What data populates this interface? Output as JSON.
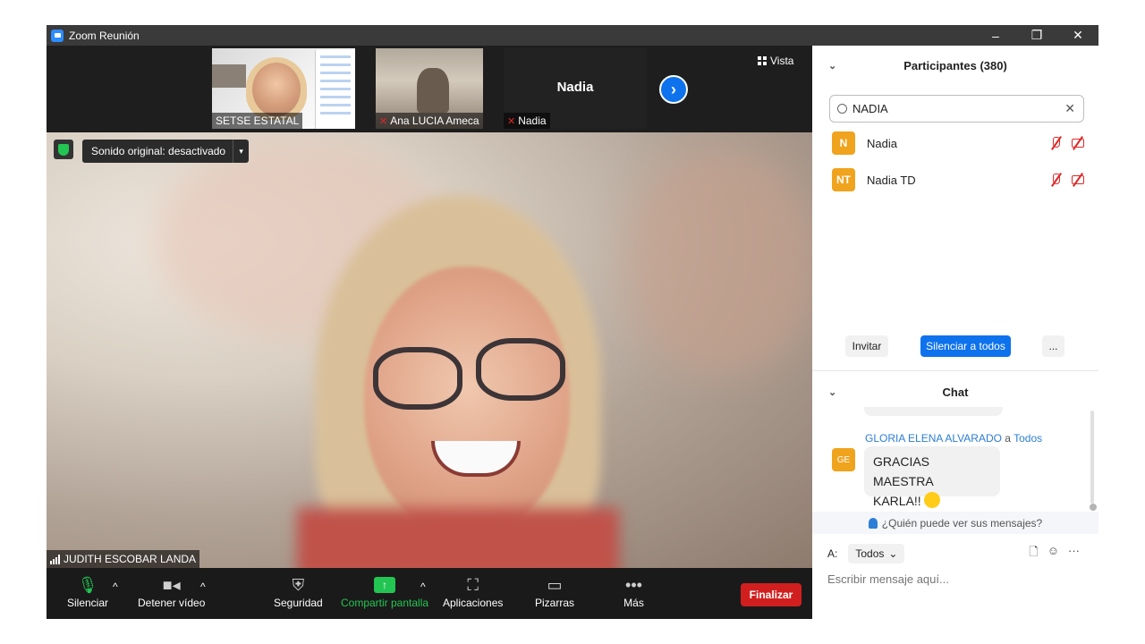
{
  "window": {
    "title": "Zoom Reunión",
    "minimize": "–",
    "restore": "❐",
    "close": "✕",
    "accent_color": "#2d8cff"
  },
  "gallery_strip": {
    "thumbnails": [
      {
        "name": "SETSE ESTATAL",
        "muted": false
      },
      {
        "name": "Ana LUCIA Ameca",
        "muted": true
      },
      {
        "name": "Nadia",
        "muted": true,
        "display_text": "Nadia"
      }
    ],
    "next_icon": "›",
    "view_label": "Vista"
  },
  "main_video": {
    "original_sound_label": "Sonido original: desactivado",
    "dropdown_caret": "▾",
    "speaker_name": "JUDITH ESCOBAR LANDA"
  },
  "toolbar": {
    "buttons": [
      {
        "label": "Silenciar",
        "icon": "microphone-icon"
      },
      {
        "label": "Detener vídeo",
        "icon": "video-camera-icon"
      },
      {
        "label": "Seguridad",
        "icon": "shield-icon"
      },
      {
        "label": "Compartir pantalla",
        "icon": "share-screen-icon"
      },
      {
        "label": "Aplicaciones",
        "icon": "apps-icon"
      },
      {
        "label": "Pizarras",
        "icon": "whiteboard-icon"
      },
      {
        "label": "Más",
        "icon": "more-icon"
      }
    ],
    "caret": "^",
    "end_label": "Finalizar",
    "end_color": "#d11f1f",
    "share_color": "#23c552"
  },
  "participants": {
    "title": "Participantes (380)",
    "collapse_icon": "⌄",
    "search_value": "NADIA",
    "clear_icon": "✕",
    "list": [
      {
        "initials": "N",
        "name": "Nadia"
      },
      {
        "initials": "NT",
        "name": "Nadia TD"
      }
    ],
    "invite_label": "Invitar",
    "mute_all_label": "Silenciar a todos",
    "more_label": "...",
    "avatar_color": "#f0a31c"
  },
  "chat": {
    "title": "Chat",
    "message": {
      "avatar": "GE",
      "sender": "GLORIA ELENA ALVARADO",
      "connector": "a",
      "recipient": "Todos",
      "line1": "GRACIAS MAESTRA",
      "line2": "KARLA!!"
    },
    "who_sees": "¿Quién puede ver sus mensajes?",
    "to_label": "A:",
    "to_value": "Todos",
    "to_caret": "⌄",
    "input_placeholder": "Escribir mensaje aquí...",
    "icons": [
      "file-icon",
      "emoji-icon",
      "more-icon"
    ],
    "file_glyph": "🗋",
    "emoji_glyph": "☺",
    "more_glyph": "···"
  }
}
